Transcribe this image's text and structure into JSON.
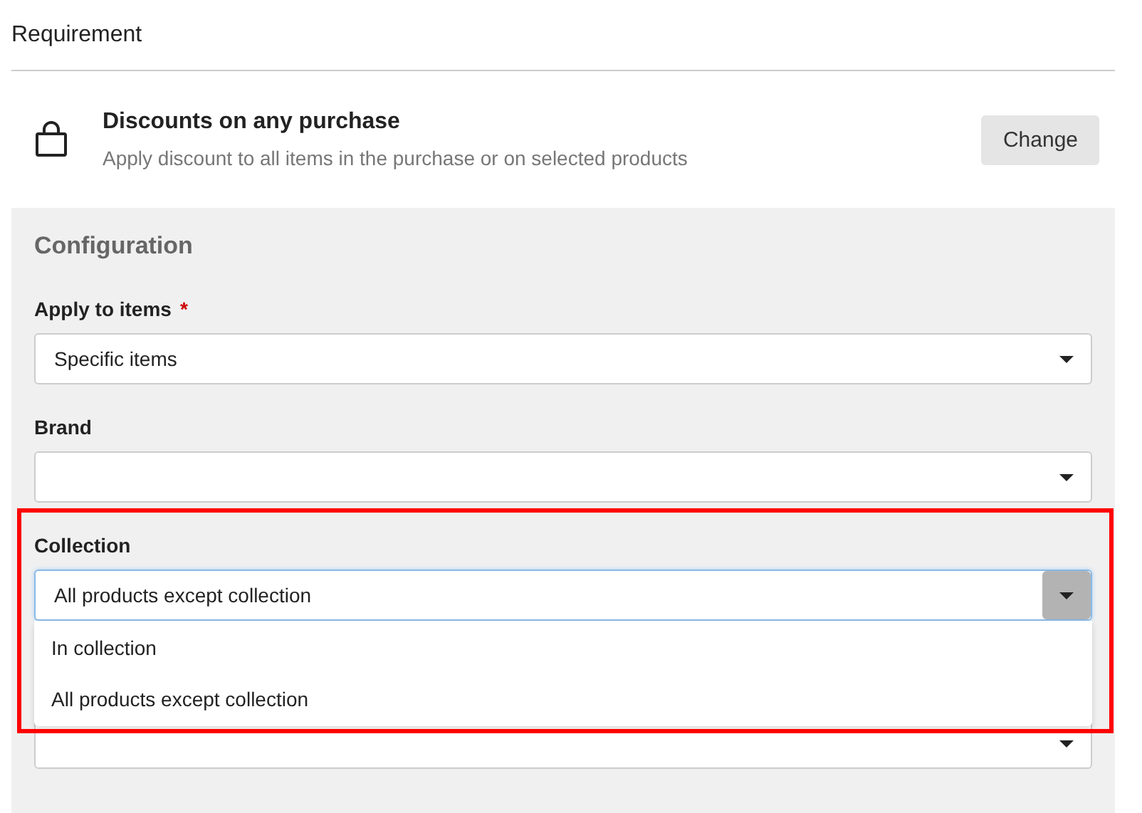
{
  "section_title": "Requirement",
  "requirement": {
    "title": "Discounts on any purchase",
    "description": "Apply discount to all items in the purchase or on selected products",
    "button": "Change"
  },
  "configuration": {
    "title": "Configuration",
    "fields": [
      {
        "label": "Apply to items",
        "required_mark": "*",
        "value": "Specific items",
        "open": false,
        "highlighted": false
      },
      {
        "label": "Brand",
        "open": false,
        "highlighted": false
      },
      {
        "label": "Collection",
        "value": "All products except collection",
        "open": true,
        "highlighted": true,
        "options": [
          "In collection",
          "All products except collection"
        ]
      },
      {
        "open": false,
        "highlighted": false
      }
    ]
  }
}
